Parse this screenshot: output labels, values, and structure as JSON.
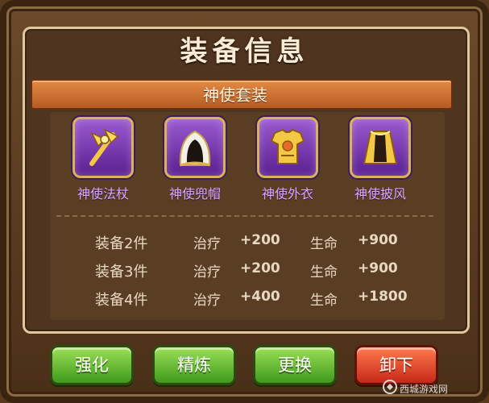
{
  "dialog": {
    "title": "装备信息",
    "set_name": "神使套装"
  },
  "items": [
    {
      "name": "神使法杖",
      "icon": "staff-icon"
    },
    {
      "name": "神使兜帽",
      "icon": "hood-icon"
    },
    {
      "name": "神使外衣",
      "icon": "armor-icon"
    },
    {
      "name": "神使披风",
      "icon": "cloak-icon"
    }
  ],
  "set_bonuses": [
    {
      "pieces": "装备2件",
      "stat1": "治疗",
      "val1": "+200",
      "stat2": "生命",
      "val2": "+900"
    },
    {
      "pieces": "装备3件",
      "stat1": "治疗",
      "val1": "+200",
      "stat2": "生命",
      "val2": "+900"
    },
    {
      "pieces": "装备4件",
      "stat1": "治疗",
      "val1": "+400",
      "stat2": "生命",
      "val2": "+1800"
    }
  ],
  "buttons": {
    "enhance": "强化",
    "refine": "精炼",
    "replace": "更换",
    "unequip": "卸下"
  },
  "watermark": "西城游戏网",
  "colors": {
    "item_bg": "#7a3fb0",
    "item_label": "#d9a7ff",
    "green_button": "#5cb82a",
    "red_button": "#e0452a"
  }
}
